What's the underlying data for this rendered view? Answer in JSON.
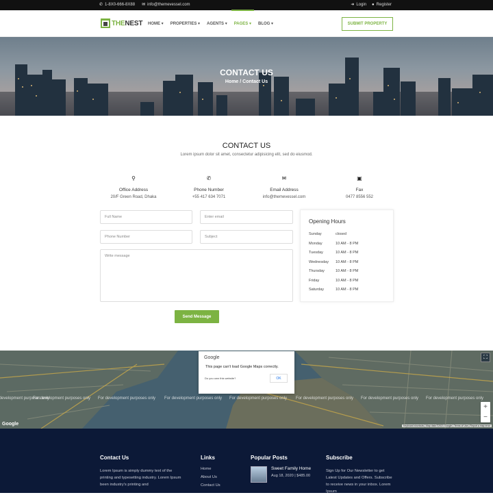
{
  "topbar": {
    "phone": "1-8X0-666-8X88",
    "email": "info@themevessel.com",
    "login": "Login",
    "register": "Register"
  },
  "navbar": {
    "logo_a": "THE",
    "logo_b": "NEST",
    "items": [
      {
        "label": "HOME ▾"
      },
      {
        "label": "PROPERTIES ▾"
      },
      {
        "label": "AGENTS ▾"
      },
      {
        "label": "PAGES ▾"
      },
      {
        "label": "BLOG ▾"
      }
    ],
    "submit_label": "SUBMIT PROPERTY"
  },
  "hero": {
    "title": "CONTACT US",
    "crumb_home": "Home",
    "crumb_sep": "/",
    "crumb_current": "Contact Us"
  },
  "contact": {
    "title": "CONTACT US",
    "subtitle": "Lorem ipsum dolor sit amet, consectetur adipisicing elit, sed do eiusmod.",
    "info": [
      {
        "icon": "map-pin-icon",
        "label": "Office Address",
        "value": "20/F Green Road, Dhaka"
      },
      {
        "icon": "phone-icon",
        "label": "Phone Number",
        "value": "+55 417 634 7071"
      },
      {
        "icon": "envelope-icon",
        "label": "Email Address",
        "value": "info@themevessel.com"
      },
      {
        "icon": "fax-icon",
        "label": "Fax",
        "value": "0477 8556 552"
      }
    ],
    "form": {
      "full_name": "Full Name",
      "email": "Enter email",
      "phone": "Phone Number",
      "subject": "Subject",
      "message": "Write message",
      "send": "Send Message"
    }
  },
  "hours": {
    "title": "Opening Hours",
    "rows": [
      {
        "day": "Sunday",
        "time": "closed"
      },
      {
        "day": "Monday",
        "time": "10 AM - 8 PM"
      },
      {
        "day": "Tuesday",
        "time": "10 AM - 8 PM"
      },
      {
        "day": "Wednesday",
        "time": "10 AM - 8 PM"
      },
      {
        "day": "Thursday",
        "time": "10 AM - 8 PM"
      },
      {
        "day": "Friday",
        "time": "10 AM - 8 PM"
      },
      {
        "day": "Saturday",
        "time": "10 AM - 8 PM"
      }
    ]
  },
  "map": {
    "dev_text": "For development purposes only",
    "dialog_brand": "Google",
    "dialog_message": "This page can't load Google Maps correctly.",
    "dialog_question": "Do you own this website?",
    "dialog_ok": "OK",
    "watermark": "Google",
    "footer_text": "Keyboard shortcuts | Map data ©2021 Google | Terms of Use | Report a map error",
    "zoom_in": "+",
    "zoom_out": "−"
  },
  "footer": {
    "contact_title": "Contact Us",
    "contact_text": "Lorem Ipsum is simply dummy text of the printing and typesetting industry. Lorem Ipsum been industry's printing and",
    "links_title": "Links",
    "links": [
      "Home",
      "About Us",
      "Contact Us"
    ],
    "posts_title": "Popular Posts",
    "post_title": "Sweet Family Home",
    "post_meta": "Aug 18, 2020 | $485.00",
    "subscribe_title": "Subscribe",
    "subscribe_text": "Sign Up for Our Newsletter to get Latest Updates and Offers. Subscribe to receive news in your inbox. Lorem Ipsum"
  }
}
